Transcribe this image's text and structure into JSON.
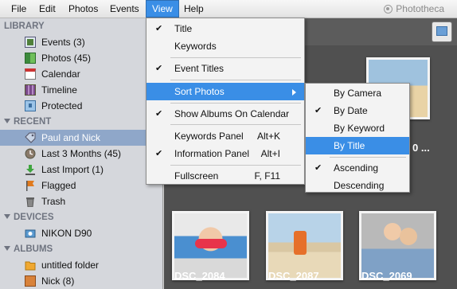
{
  "menubar": {
    "items": [
      "File",
      "Edit",
      "Photos",
      "Events",
      "View",
      "Help"
    ],
    "app_name": "Phototheca"
  },
  "sidebar": {
    "library_header": "LIBRARY",
    "library": [
      {
        "label": "Events (3)",
        "icon": "events-icon"
      },
      {
        "label": "Photos (45)",
        "icon": "photos-icon"
      },
      {
        "label": "Calendar",
        "icon": "calendar-icon"
      },
      {
        "label": "Timeline",
        "icon": "timeline-icon"
      },
      {
        "label": "Protected",
        "icon": "protected-icon"
      }
    ],
    "recent_header": "RECENT",
    "recent": [
      {
        "label": "Paul and Nick",
        "icon": "tag-icon"
      },
      {
        "label": "Last 3 Months (45)",
        "icon": "clock-icon"
      },
      {
        "label": "Last Import (1)",
        "icon": "import-icon"
      },
      {
        "label": "Flagged",
        "icon": "flag-icon"
      },
      {
        "label": "Trash",
        "icon": "trash-icon"
      }
    ],
    "devices_header": "DEVICES",
    "devices": [
      {
        "label": "NIKON D90",
        "icon": "camera-icon"
      }
    ],
    "albums_header": "ALBUMS",
    "albums": [
      {
        "label": "untitled folder",
        "icon": "folder-icon"
      },
      {
        "label": "Nick (8)",
        "icon": "album-icon"
      }
    ]
  },
  "view_menu": {
    "items": [
      {
        "label": "Title",
        "checked": true,
        "shortcut": ""
      },
      {
        "label": "Keywords",
        "checked": false,
        "shortcut": ""
      },
      {
        "label": "Event Titles",
        "checked": true,
        "shortcut": ""
      },
      {
        "label": "Sort Photos",
        "checked": false,
        "shortcut": "",
        "submenu": true
      },
      {
        "label": "Show Albums On Calendar",
        "checked": true,
        "shortcut": ""
      },
      {
        "label": "Keywords Panel",
        "checked": false,
        "shortcut": "Alt+K"
      },
      {
        "label": "Information Panel",
        "checked": true,
        "shortcut": "Alt+I"
      },
      {
        "label": "Fullscreen",
        "checked": false,
        "shortcut": "F, F11"
      }
    ]
  },
  "sort_submenu": {
    "items": [
      {
        "label": "By Camera",
        "checked": false
      },
      {
        "label": "By Date",
        "checked": true
      },
      {
        "label": "By Keyword",
        "checked": false
      },
      {
        "label": "By Title",
        "checked": false
      },
      {
        "label": "Ascending",
        "checked": true
      },
      {
        "label": "Descending",
        "checked": false
      }
    ]
  },
  "photos": {
    "captions": [
      "DSC_2084",
      "DSC_2087",
      "DSC_2069"
    ],
    "partial_caption": "0 ..."
  },
  "colors": {
    "accent": "#3a8ee6",
    "sidebar_bg": "#d5d7dc",
    "main_bg": "#505050",
    "selected_row": "#8fa7c9"
  }
}
